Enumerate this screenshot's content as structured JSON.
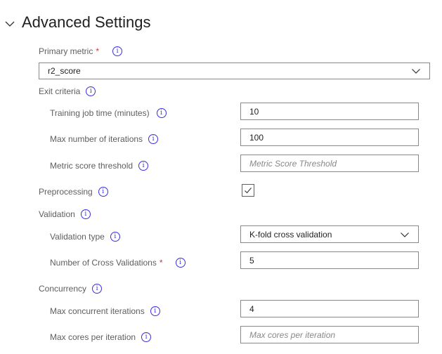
{
  "section": {
    "title": "Advanced Settings"
  },
  "primary_metric": {
    "label": "Primary metric",
    "required": "*",
    "value": "r2_score"
  },
  "exit_criteria": {
    "label": "Exit criteria",
    "training_job_time": {
      "label": "Training job time (minutes)",
      "value": "10"
    },
    "max_iterations": {
      "label": "Max number of iterations",
      "value": "100"
    },
    "metric_score_threshold": {
      "label": "Metric score threshold",
      "placeholder": "Metric Score Threshold"
    }
  },
  "preprocessing": {
    "label": "Preprocessing",
    "checked": true
  },
  "validation": {
    "label": "Validation",
    "validation_type": {
      "label": "Validation type",
      "value": "K-fold cross validation"
    },
    "cross_validations": {
      "label": "Number of Cross Validations",
      "required": "*",
      "value": "5"
    }
  },
  "concurrency": {
    "label": "Concurrency",
    "max_concurrent_iterations": {
      "label": "Max concurrent iterations",
      "value": "4"
    },
    "max_cores_per_iteration": {
      "label": "Max cores per iteration",
      "placeholder": "Max cores per iteration"
    }
  },
  "icons": {
    "info": "info-icon",
    "chevron": "chevron-down-icon",
    "check": "checkmark-icon"
  },
  "colors": {
    "info_accent": "#3a2fe0",
    "required": "#d13438",
    "border": "#8a8886"
  }
}
